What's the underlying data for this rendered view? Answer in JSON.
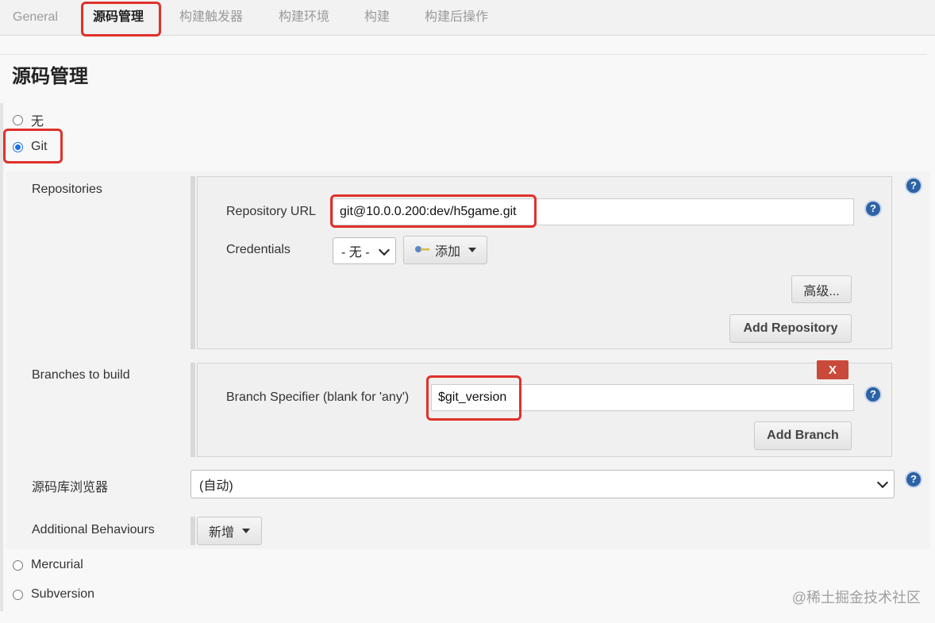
{
  "tabs": [
    {
      "label": "General",
      "active": false
    },
    {
      "label": "源码管理",
      "active": true
    },
    {
      "label": "构建触发器",
      "active": false
    },
    {
      "label": "构建环境",
      "active": false
    },
    {
      "label": "构建",
      "active": false
    },
    {
      "label": "构建后操作",
      "active": false
    }
  ],
  "section_title": "源码管理",
  "scm_options": {
    "none": "无",
    "git": "Git",
    "mercurial": "Mercurial",
    "subversion": "Subversion",
    "selected": "Git"
  },
  "repositories": {
    "label": "Repositories",
    "url_label": "Repository URL",
    "url_value": "git@10.0.0.200:dev/h5game.git",
    "credentials_label": "Credentials",
    "credentials_value": "- 无 -",
    "add_label": "添加",
    "advanced_label": "高级...",
    "add_repository_label": "Add Repository"
  },
  "branches": {
    "label": "Branches to build",
    "specifier_label": "Branch Specifier (blank for 'any')",
    "specifier_value": "$git_version",
    "delete_label": "X",
    "add_branch_label": "Add Branch"
  },
  "browser": {
    "label": "源码库浏览器",
    "value": "(自动)"
  },
  "behaviours": {
    "label": "Additional Behaviours",
    "add_label": "新增"
  },
  "help_glyph": "?",
  "watermark": "@稀土掘金技术社区",
  "colors": {
    "highlight": "#e0312b",
    "radio_checked": "#1e6fe3",
    "help_icon": "#2d63a6",
    "delete_button": "#c94a3a"
  }
}
